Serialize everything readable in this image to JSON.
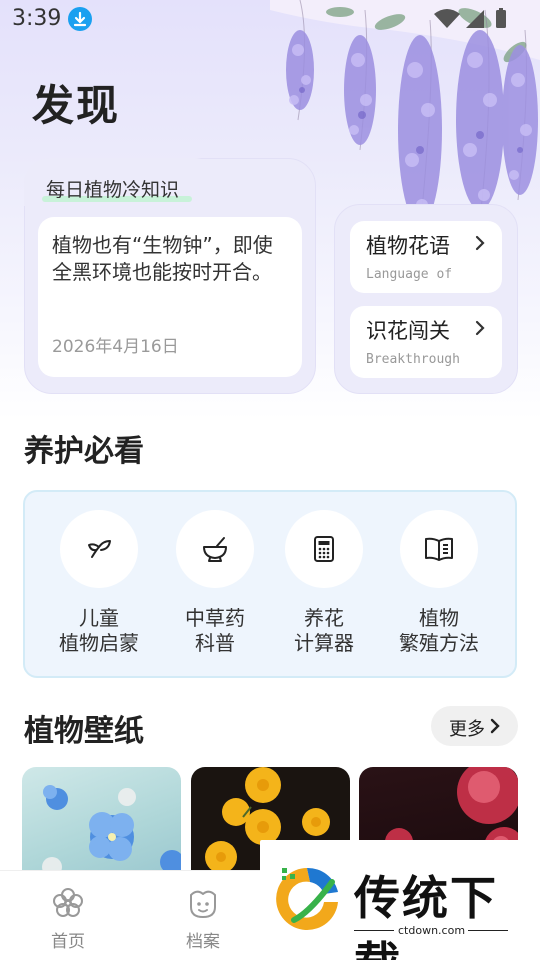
{
  "status_bar": {
    "time": "3:39"
  },
  "page_title": "发现",
  "daily_fact": {
    "label": "每日植物冷知识",
    "text": "植物也有“生物钟”，即使全黑环境也能按时开合。",
    "date": "2026年4月16日"
  },
  "side_cards": [
    {
      "title": "植物花语",
      "subtitle": "Language of"
    },
    {
      "title": "识花闯关",
      "subtitle": "Breakthrough"
    }
  ],
  "care_section": {
    "title": "养护必看",
    "items": [
      {
        "label": "儿童\n植物启蒙",
        "icon": "sprout-icon"
      },
      {
        "label": "中草药\n科普",
        "icon": "mortar-icon"
      },
      {
        "label": "养花\n计算器",
        "icon": "calculator-icon"
      },
      {
        "label": "植物\n繁殖方法",
        "icon": "book-icon"
      }
    ]
  },
  "wallpaper_section": {
    "title": "植物壁纸",
    "more_label": "更多"
  },
  "bottom_nav": [
    {
      "label": "首页",
      "icon": "flower-icon"
    },
    {
      "label": "档案",
      "icon": "plant-face-icon"
    }
  ],
  "watermark": {
    "brand": "传统下载",
    "url": "ctdown.com"
  },
  "colors": {
    "accent_green": "#c8f2d9",
    "panel_lavender": "#ecebfa",
    "care_panel": "#eef5fd"
  }
}
